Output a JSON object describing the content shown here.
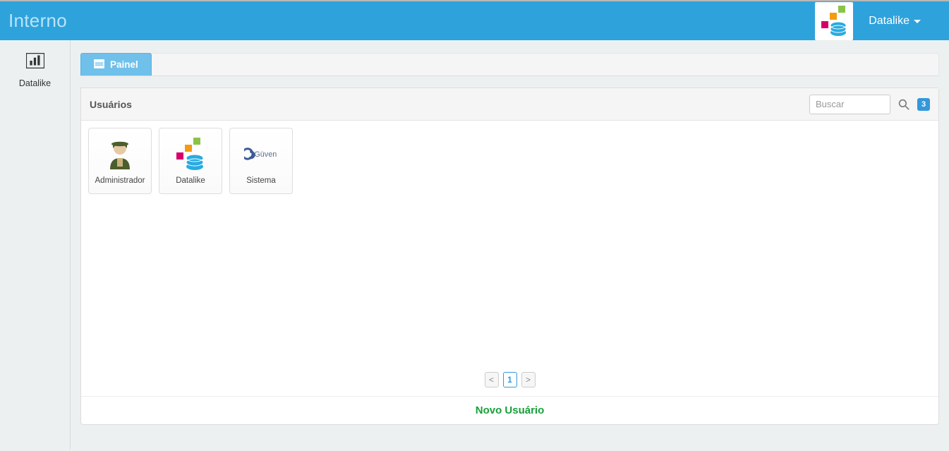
{
  "header": {
    "title": "Interno",
    "user_label": "Datalike"
  },
  "sidebar": {
    "items": [
      {
        "label": "Datalike"
      }
    ]
  },
  "tabs": [
    {
      "label": "Painel"
    }
  ],
  "panel": {
    "title": "Usuários",
    "search_placeholder": "Buscar",
    "count": "3",
    "new_label": "Novo Usuário"
  },
  "users": [
    {
      "label": "Administrador",
      "icon": "admin"
    },
    {
      "label": "Datalike",
      "icon": "datalike"
    },
    {
      "label": "Sistema",
      "icon": "guven"
    }
  ],
  "pager": {
    "prev": "<",
    "current": "1",
    "next": ">"
  }
}
